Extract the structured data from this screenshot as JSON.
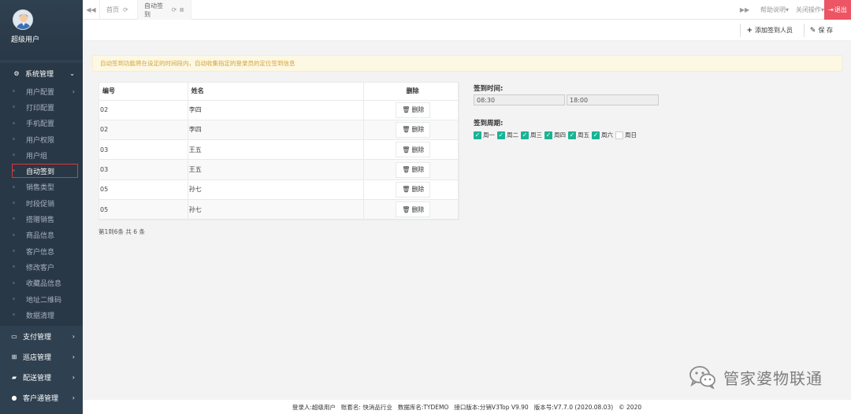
{
  "user": {
    "name": "超级用户"
  },
  "colors": {
    "sidebar": "#2f4050",
    "accent": "#1ab394",
    "logout": "#ed5565",
    "alert_bg": "#fcf8e3",
    "alert_text": "#d6a23a"
  },
  "sidebar": {
    "groups": [
      {
        "label": "系统管理",
        "icon": "cogs-icon"
      },
      {
        "label": "支付管理",
        "icon": "credit-card-icon"
      },
      {
        "label": "巡店管理",
        "icon": "sitemap-icon"
      },
      {
        "label": "配送管理",
        "icon": "truck-icon"
      },
      {
        "label": "客户通管理",
        "icon": "users-icon"
      }
    ],
    "system_items": [
      "用户配置",
      "打印配置",
      "手机配置",
      "用户权限",
      "用户组",
      "自动签到",
      "销售类型",
      "时段促销",
      "搭赠销售",
      "商品信息",
      "客户信息",
      "修改客户",
      "收藏品信息",
      "地址二维码",
      "数据清理"
    ]
  },
  "tabs": {
    "home": "首页",
    "active": "自动签到"
  },
  "topbar": {
    "help": "帮助说明",
    "close_ops": "关闭操作",
    "logout": "退出"
  },
  "toolbar": {
    "add": "添加签到人员",
    "save": "保 存"
  },
  "alert": "自动签到功能将在设定的时间段内，自动收集指定的登录员的定位签到信息",
  "table": {
    "headers": {
      "id": "编号",
      "name": "姓名",
      "delete": "删除"
    },
    "rows": [
      {
        "id": "02",
        "name": "李四"
      },
      {
        "id": "02",
        "name": "李四"
      },
      {
        "id": "03",
        "name": "王五"
      },
      {
        "id": "03",
        "name": "王五"
      },
      {
        "id": "05",
        "name": "孙七"
      },
      {
        "id": "05",
        "name": "孙七"
      }
    ],
    "delete_label": "删除"
  },
  "pager": "第1到6条 共 6 条",
  "form": {
    "time_label": "签到时间:",
    "time_start": "08:30",
    "time_end": "18:00",
    "weekly_label": "签到周期:",
    "days": [
      {
        "label": "周一",
        "checked": true
      },
      {
        "label": "周二",
        "checked": true
      },
      {
        "label": "周三",
        "checked": true
      },
      {
        "label": "周四",
        "checked": true
      },
      {
        "label": "周五",
        "checked": true
      },
      {
        "label": "周六",
        "checked": true
      },
      {
        "label": "周日",
        "checked": false
      }
    ]
  },
  "footer": {
    "login": "登录人:超级用户",
    "account": "账套名: 快消品行业",
    "db": "数据库名:TYDEMO",
    "api": "接口版本:分销V3Top V9.90",
    "version": "版本号:V7.7.0 (2020.08.03)",
    "copyright": "© 2020"
  },
  "watermark": "管家婆物联通"
}
